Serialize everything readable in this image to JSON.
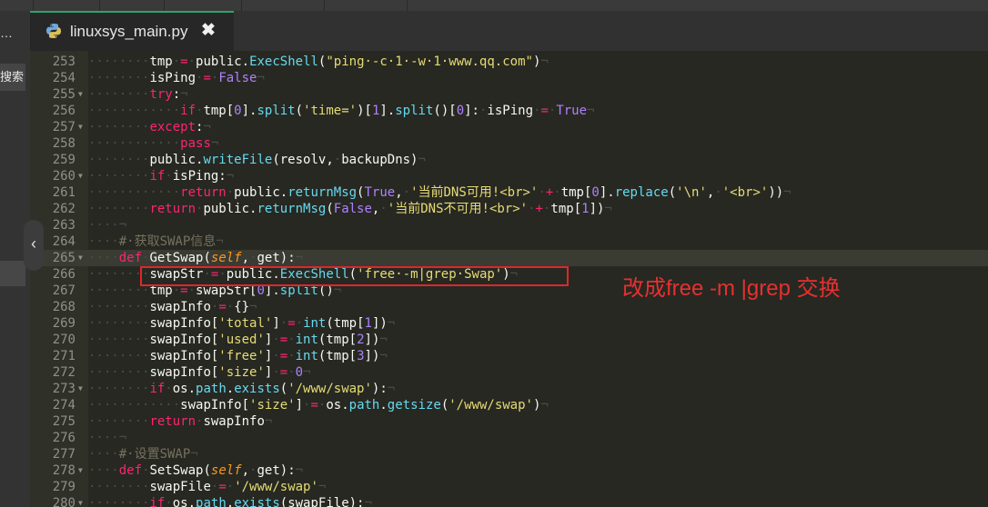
{
  "top_tabs": [
    "",
    "",
    "",
    "",
    "",
    ""
  ],
  "left_panel": {
    "ellipsis": "…",
    "search_label": "搜索",
    "collapse_glyph": "‹"
  },
  "editor_tab": {
    "filename": "linuxsys_main.py",
    "close_glyph": "✖"
  },
  "annotation": {
    "text": "改成free -m |grep 交换",
    "color": "#e8302f"
  },
  "colors": {
    "keyword": "#f92672",
    "function": "#66d9ef",
    "string": "#e6db74",
    "constant": "#ae81ff",
    "comment": "#75715e",
    "tab_accent": "#2ea36c"
  },
  "active_line": 265,
  "lines": [
    {
      "n": 253,
      "fold": false,
      "segs": [
        [
          "i",
          "········"
        ],
        [
          "w",
          "tmp"
        ],
        [
          "e",
          "·"
        ],
        [
          "k",
          "="
        ],
        [
          "e",
          "·"
        ],
        [
          "w",
          "public."
        ],
        [
          "f",
          "ExecShell"
        ],
        [
          "w",
          "("
        ],
        [
          "s",
          "\"ping·-c·1·-w·1·www.qq.com\""
        ],
        [
          "w",
          ")"
        ],
        [
          "e",
          "¬"
        ]
      ]
    },
    {
      "n": 254,
      "fold": false,
      "segs": [
        [
          "i",
          "········"
        ],
        [
          "w",
          "isPing"
        ],
        [
          "e",
          "·"
        ],
        [
          "k",
          "="
        ],
        [
          "e",
          "·"
        ],
        [
          "b",
          "False"
        ],
        [
          "e",
          "¬"
        ]
      ]
    },
    {
      "n": 255,
      "fold": true,
      "segs": [
        [
          "i",
          "········"
        ],
        [
          "k",
          "try"
        ],
        [
          "w",
          ":"
        ],
        [
          "e",
          "¬"
        ]
      ]
    },
    {
      "n": 256,
      "fold": false,
      "segs": [
        [
          "i",
          "············"
        ],
        [
          "k",
          "if"
        ],
        [
          "e",
          "·"
        ],
        [
          "w",
          "tmp["
        ],
        [
          "b",
          "0"
        ],
        [
          "w",
          "]."
        ],
        [
          "f",
          "split"
        ],
        [
          "w",
          "("
        ],
        [
          "s",
          "'time='"
        ],
        [
          "w",
          ")["
        ],
        [
          "b",
          "1"
        ],
        [
          "w",
          "]."
        ],
        [
          "f",
          "split"
        ],
        [
          "w",
          "()["
        ],
        [
          "b",
          "0"
        ],
        [
          "w",
          "]:"
        ],
        [
          "e",
          "·"
        ],
        [
          "w",
          "isPing"
        ],
        [
          "e",
          "·"
        ],
        [
          "k",
          "="
        ],
        [
          "e",
          "·"
        ],
        [
          "b",
          "True"
        ],
        [
          "e",
          "¬"
        ]
      ]
    },
    {
      "n": 257,
      "fold": true,
      "segs": [
        [
          "i",
          "········"
        ],
        [
          "k",
          "except"
        ],
        [
          "w",
          ":"
        ],
        [
          "e",
          "¬"
        ]
      ]
    },
    {
      "n": 258,
      "fold": false,
      "segs": [
        [
          "i",
          "············"
        ],
        [
          "k",
          "pass"
        ],
        [
          "e",
          "¬"
        ]
      ]
    },
    {
      "n": 259,
      "fold": false,
      "segs": [
        [
          "i",
          "········"
        ],
        [
          "w",
          "public."
        ],
        [
          "f",
          "writeFile"
        ],
        [
          "w",
          "(resolv,"
        ],
        [
          "e",
          "·"
        ],
        [
          "w",
          "backupDns)"
        ],
        [
          "e",
          "¬"
        ]
      ]
    },
    {
      "n": 260,
      "fold": true,
      "segs": [
        [
          "i",
          "········"
        ],
        [
          "k",
          "if"
        ],
        [
          "e",
          "·"
        ],
        [
          "w",
          "isPing:"
        ],
        [
          "e",
          "¬"
        ]
      ]
    },
    {
      "n": 261,
      "fold": false,
      "segs": [
        [
          "i",
          "············"
        ],
        [
          "k",
          "return"
        ],
        [
          "e",
          "·"
        ],
        [
          "w",
          "public."
        ],
        [
          "f",
          "returnMsg"
        ],
        [
          "w",
          "("
        ],
        [
          "b",
          "True"
        ],
        [
          "w",
          ","
        ],
        [
          "e",
          "·"
        ],
        [
          "s",
          "'当前DNS可用!<br>'"
        ],
        [
          "e",
          "·"
        ],
        [
          "k",
          "+"
        ],
        [
          "e",
          "·"
        ],
        [
          "w",
          "tmp["
        ],
        [
          "b",
          "0"
        ],
        [
          "w",
          "]."
        ],
        [
          "f",
          "replace"
        ],
        [
          "w",
          "("
        ],
        [
          "s",
          "'\\n'"
        ],
        [
          "w",
          ","
        ],
        [
          "e",
          "·"
        ],
        [
          "s",
          "'<br>'"
        ],
        [
          "w",
          "))"
        ],
        [
          "e",
          "¬"
        ]
      ]
    },
    {
      "n": 262,
      "fold": false,
      "segs": [
        [
          "i",
          "········"
        ],
        [
          "k",
          "return"
        ],
        [
          "e",
          "·"
        ],
        [
          "w",
          "public."
        ],
        [
          "f",
          "returnMsg"
        ],
        [
          "w",
          "("
        ],
        [
          "b",
          "False"
        ],
        [
          "w",
          ","
        ],
        [
          "e",
          "·"
        ],
        [
          "s",
          "'当前DNS不可用!<br>'"
        ],
        [
          "e",
          "·"
        ],
        [
          "k",
          "+"
        ],
        [
          "e",
          "·"
        ],
        [
          "w",
          "tmp["
        ],
        [
          "b",
          "1"
        ],
        [
          "w",
          "])"
        ],
        [
          "e",
          "¬"
        ]
      ]
    },
    {
      "n": 263,
      "fold": false,
      "segs": [
        [
          "i",
          "····"
        ],
        [
          "e",
          "¬"
        ]
      ]
    },
    {
      "n": 264,
      "fold": false,
      "segs": [
        [
          "i",
          "····"
        ],
        [
          "c",
          "#·获取SWAP信息"
        ],
        [
          "e",
          "¬"
        ]
      ]
    },
    {
      "n": 265,
      "fold": true,
      "segs": [
        [
          "i",
          "····"
        ],
        [
          "k",
          "def"
        ],
        [
          "e",
          "·"
        ],
        [
          "w",
          "GetSwap("
        ],
        [
          "sf",
          "self"
        ],
        [
          "w",
          ","
        ],
        [
          "e",
          "·"
        ],
        [
          "w",
          "get):"
        ],
        [
          "e",
          "¬"
        ]
      ]
    },
    {
      "n": 266,
      "fold": false,
      "segs": [
        [
          "i",
          "········"
        ],
        [
          "w",
          "swapStr"
        ],
        [
          "e",
          "·"
        ],
        [
          "k",
          "="
        ],
        [
          "e",
          "·"
        ],
        [
          "w",
          "public."
        ],
        [
          "f",
          "ExecShell"
        ],
        [
          "w",
          "("
        ],
        [
          "s",
          "'free·-m|grep·Swap'"
        ],
        [
          "w",
          ")"
        ],
        [
          "e",
          "¬"
        ]
      ]
    },
    {
      "n": 267,
      "fold": false,
      "segs": [
        [
          "i",
          "········"
        ],
        [
          "w",
          "tmp"
        ],
        [
          "e",
          "·"
        ],
        [
          "k",
          "="
        ],
        [
          "e",
          "·"
        ],
        [
          "w",
          "swapStr["
        ],
        [
          "b",
          "0"
        ],
        [
          "w",
          "]."
        ],
        [
          "f",
          "split"
        ],
        [
          "w",
          "()"
        ],
        [
          "e",
          "¬"
        ]
      ]
    },
    {
      "n": 268,
      "fold": false,
      "segs": [
        [
          "i",
          "········"
        ],
        [
          "w",
          "swapInfo"
        ],
        [
          "e",
          "·"
        ],
        [
          "k",
          "="
        ],
        [
          "e",
          "·"
        ],
        [
          "w",
          "{}"
        ],
        [
          "e",
          "¬"
        ]
      ]
    },
    {
      "n": 269,
      "fold": false,
      "segs": [
        [
          "i",
          "········"
        ],
        [
          "w",
          "swapInfo["
        ],
        [
          "s",
          "'total'"
        ],
        [
          "w",
          "]"
        ],
        [
          "e",
          "·"
        ],
        [
          "k",
          "="
        ],
        [
          "e",
          "·"
        ],
        [
          "f",
          "int"
        ],
        [
          "w",
          "(tmp["
        ],
        [
          "b",
          "1"
        ],
        [
          "w",
          "])"
        ],
        [
          "e",
          "¬"
        ]
      ]
    },
    {
      "n": 270,
      "fold": false,
      "segs": [
        [
          "i",
          "········"
        ],
        [
          "w",
          "swapInfo["
        ],
        [
          "s",
          "'used'"
        ],
        [
          "w",
          "]"
        ],
        [
          "e",
          "·"
        ],
        [
          "k",
          "="
        ],
        [
          "e",
          "·"
        ],
        [
          "f",
          "int"
        ],
        [
          "w",
          "(tmp["
        ],
        [
          "b",
          "2"
        ],
        [
          "w",
          "])"
        ],
        [
          "e",
          "¬"
        ]
      ]
    },
    {
      "n": 271,
      "fold": false,
      "segs": [
        [
          "i",
          "········"
        ],
        [
          "w",
          "swapInfo["
        ],
        [
          "s",
          "'free'"
        ],
        [
          "w",
          "]"
        ],
        [
          "e",
          "·"
        ],
        [
          "k",
          "="
        ],
        [
          "e",
          "·"
        ],
        [
          "f",
          "int"
        ],
        [
          "w",
          "(tmp["
        ],
        [
          "b",
          "3"
        ],
        [
          "w",
          "])"
        ],
        [
          "e",
          "¬"
        ]
      ]
    },
    {
      "n": 272,
      "fold": false,
      "segs": [
        [
          "i",
          "········"
        ],
        [
          "w",
          "swapInfo["
        ],
        [
          "s",
          "'size'"
        ],
        [
          "w",
          "]"
        ],
        [
          "e",
          "·"
        ],
        [
          "k",
          "="
        ],
        [
          "e",
          "·"
        ],
        [
          "b",
          "0"
        ],
        [
          "e",
          "¬"
        ]
      ]
    },
    {
      "n": 273,
      "fold": true,
      "segs": [
        [
          "i",
          "········"
        ],
        [
          "k",
          "if"
        ],
        [
          "e",
          "·"
        ],
        [
          "w",
          "os."
        ],
        [
          "f",
          "path"
        ],
        [
          "w",
          "."
        ],
        [
          "f",
          "exists"
        ],
        [
          "w",
          "("
        ],
        [
          "s",
          "'/www/swap'"
        ],
        [
          "w",
          "):"
        ],
        [
          "e",
          "¬"
        ]
      ]
    },
    {
      "n": 274,
      "fold": false,
      "segs": [
        [
          "i",
          "············"
        ],
        [
          "w",
          "swapInfo["
        ],
        [
          "s",
          "'size'"
        ],
        [
          "w",
          "]"
        ],
        [
          "e",
          "·"
        ],
        [
          "k",
          "="
        ],
        [
          "e",
          "·"
        ],
        [
          "w",
          "os."
        ],
        [
          "f",
          "path"
        ],
        [
          "w",
          "."
        ],
        [
          "f",
          "getsize"
        ],
        [
          "w",
          "("
        ],
        [
          "s",
          "'/www/swap'"
        ],
        [
          "w",
          ")"
        ],
        [
          "e",
          "¬"
        ]
      ]
    },
    {
      "n": 275,
      "fold": false,
      "segs": [
        [
          "i",
          "········"
        ],
        [
          "k",
          "return"
        ],
        [
          "e",
          "·"
        ],
        [
          "w",
          "swapInfo"
        ],
        [
          "e",
          "¬"
        ]
      ]
    },
    {
      "n": 276,
      "fold": false,
      "segs": [
        [
          "i",
          "····"
        ],
        [
          "e",
          "¬"
        ]
      ]
    },
    {
      "n": 277,
      "fold": false,
      "segs": [
        [
          "i",
          "····"
        ],
        [
          "c",
          "#·设置SWAP"
        ],
        [
          "e",
          "¬"
        ]
      ]
    },
    {
      "n": 278,
      "fold": true,
      "segs": [
        [
          "i",
          "····"
        ],
        [
          "k",
          "def"
        ],
        [
          "e",
          "·"
        ],
        [
          "w",
          "SetSwap("
        ],
        [
          "sf",
          "self"
        ],
        [
          "w",
          ","
        ],
        [
          "e",
          "·"
        ],
        [
          "w",
          "get):"
        ],
        [
          "e",
          "¬"
        ]
      ]
    },
    {
      "n": 279,
      "fold": false,
      "segs": [
        [
          "i",
          "········"
        ],
        [
          "w",
          "swapFile"
        ],
        [
          "e",
          "·"
        ],
        [
          "k",
          "="
        ],
        [
          "e",
          "·"
        ],
        [
          "s",
          "'/www/swap'"
        ],
        [
          "e",
          "¬"
        ]
      ]
    },
    {
      "n": 280,
      "fold": true,
      "segs": [
        [
          "i",
          "········"
        ],
        [
          "k",
          "if"
        ],
        [
          "e",
          "·"
        ],
        [
          "w",
          "os."
        ],
        [
          "f",
          "path"
        ],
        [
          "w",
          "."
        ],
        [
          "f",
          "exists"
        ],
        [
          "w",
          "(swapFile):"
        ],
        [
          "e",
          "¬"
        ]
      ]
    }
  ]
}
